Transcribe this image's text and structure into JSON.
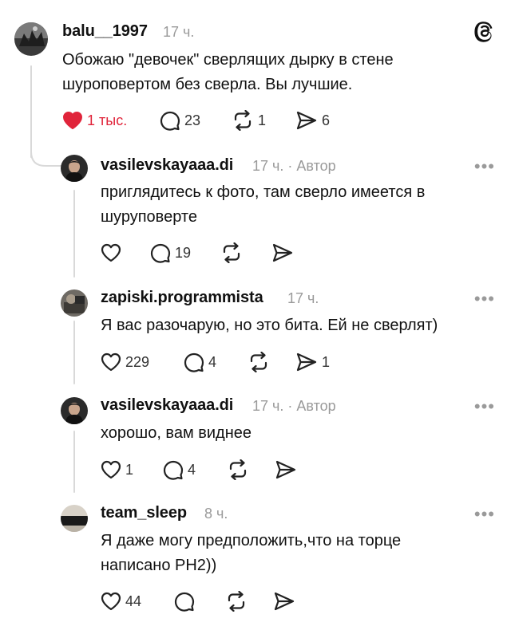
{
  "root": {
    "username": "balu__1997",
    "time": "17 ч.",
    "text_line1": "Обожаю \"девочек\" сверлящих дырку в стене",
    "text_line2": "шуроповертом без сверла. Вы лучшие.",
    "likes": "1 тыс.",
    "comments": "23",
    "reposts": "1",
    "shares": "6"
  },
  "replies": [
    {
      "username": "vasilevskayaaa.di",
      "time": "17 ч.",
      "author_tag": "· Автор",
      "text_line1": "приглядитесь к фото, там сверло имеется в",
      "text_line2": "шуруповерте",
      "likes": "",
      "comments": "19",
      "reposts": "",
      "shares": ""
    },
    {
      "username": "zapiski.programmista",
      "time": "17 ч.",
      "author_tag": "",
      "text_line1": "Я вас разочарую, но это бита. Ей не сверлят)",
      "text_line2": "",
      "likes": "229",
      "comments": "4",
      "reposts": "",
      "shares": "1"
    },
    {
      "username": "vasilevskayaaa.di",
      "time": "17 ч.",
      "author_tag": "· Автор",
      "text_line1": "хорошо, вам виднее",
      "text_line2": "",
      "likes": "1",
      "comments": "4",
      "reposts": "",
      "shares": ""
    },
    {
      "username": "team_sleep",
      "time": "8 ч.",
      "author_tag": "",
      "text_line1": "Я даже могу предположить,что на торце",
      "text_line2": "написано PH2))",
      "likes": "44",
      "comments": "",
      "reposts": "",
      "shares": ""
    }
  ],
  "icons": {
    "brand": "threads-logo-icon",
    "like": "heart-icon",
    "comment": "comment-bubble-icon",
    "repost": "repost-icon",
    "share": "send-icon",
    "more": "more-dots-icon"
  },
  "colors": {
    "liked": "#e0243a",
    "muted": "#9a9a9a",
    "thread_line": "#d9d9d9"
  }
}
